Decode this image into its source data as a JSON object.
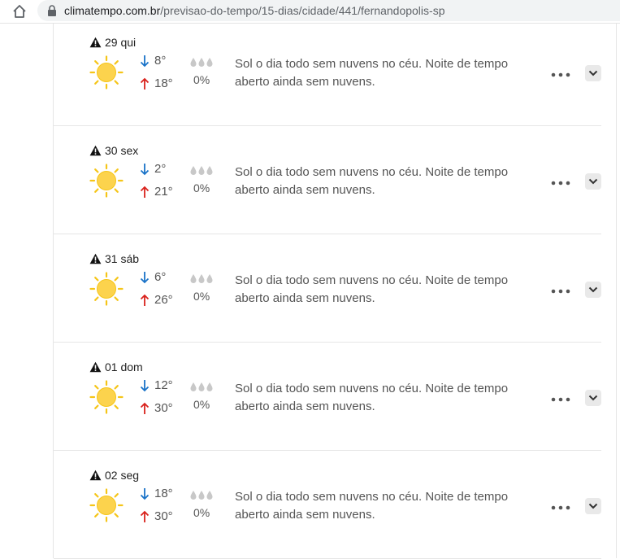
{
  "browser": {
    "url_host": "climatempo.com.br",
    "url_path": "/previsao-do-tempo/15-dias/cidade/441/fernandopolis-sp"
  },
  "days": [
    {
      "date": "29 qui",
      "min": "8°",
      "max": "18°",
      "precip": "0%",
      "description": "Sol o dia todo sem nuvens no céu. Noite de tempo aberto ainda sem nuvens."
    },
    {
      "date": "30 sex",
      "min": "2°",
      "max": "21°",
      "precip": "0%",
      "description": "Sol o dia todo sem nuvens no céu. Noite de tempo aberto ainda sem nuvens."
    },
    {
      "date": "31 sáb",
      "min": "6°",
      "max": "26°",
      "precip": "0%",
      "description": "Sol o dia todo sem nuvens no céu. Noite de tempo aberto ainda sem nuvens."
    },
    {
      "date": "01 dom",
      "min": "12°",
      "max": "30°",
      "precip": "0%",
      "description": "Sol o dia todo sem nuvens no céu. Noite de tempo aberto ainda sem nuvens."
    },
    {
      "date": "02 seg",
      "min": "18°",
      "max": "30°",
      "precip": "0%",
      "description": "Sol o dia todo sem nuvens no céu. Noite de tempo aberto ainda sem nuvens."
    }
  ],
  "icons": {
    "alert": "warning-icon",
    "weather": "sun-icon",
    "min": "arrow-down-icon",
    "max": "arrow-up-icon",
    "rain": "raindrops-icon",
    "menu": "more-icon",
    "expand": "chevron-down-icon"
  },
  "colors": {
    "min_arrow": "#1a73c8",
    "max_arrow": "#d9221c",
    "sun": "#fcd34d",
    "sun_rays": "#f5c518"
  }
}
